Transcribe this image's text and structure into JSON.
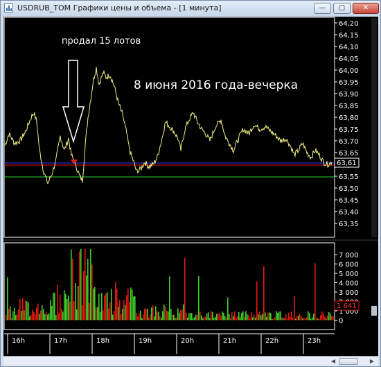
{
  "window": {
    "title": "USDRUB_TOM Графики цены и объема - [1 минута]",
    "minimize_glyph": "—",
    "maximize_glyph": "▢",
    "close_glyph": "✕"
  },
  "price_panel": {
    "y_ticks": [
      "64,20",
      "64,15",
      "64,10",
      "64,05",
      "64,00",
      "63,95",
      "63,90",
      "63,85",
      "63,80",
      "63,75",
      "63,70",
      "63,65",
      "63,60",
      "63,55",
      "63,50",
      "63,45",
      "63,40",
      "63,35"
    ],
    "current_value": "63,61",
    "line_color": "#f2ef82",
    "blue_level_color": "#2f3dff",
    "red_level_color": "#e01515",
    "green_level_color": "#2fd23a"
  },
  "volume_panel": {
    "y_ticks": [
      "7 000",
      "6 000",
      "5 000",
      "4 000",
      "3 000",
      "2 000",
      "1 000",
      "0"
    ],
    "current_value": "1 641"
  },
  "time_axis": {
    "x_ticks": [
      "16h",
      "17h",
      "18h",
      "19h",
      "20h",
      "21h",
      "22h",
      "23h"
    ]
  },
  "annotations": {
    "sold": "продал 15 лотов",
    "date_note": "8 июня 2016 года-вечерка"
  },
  "scrollbar": {
    "left_arrow": "◀",
    "right_arrow": "▶"
  }
}
